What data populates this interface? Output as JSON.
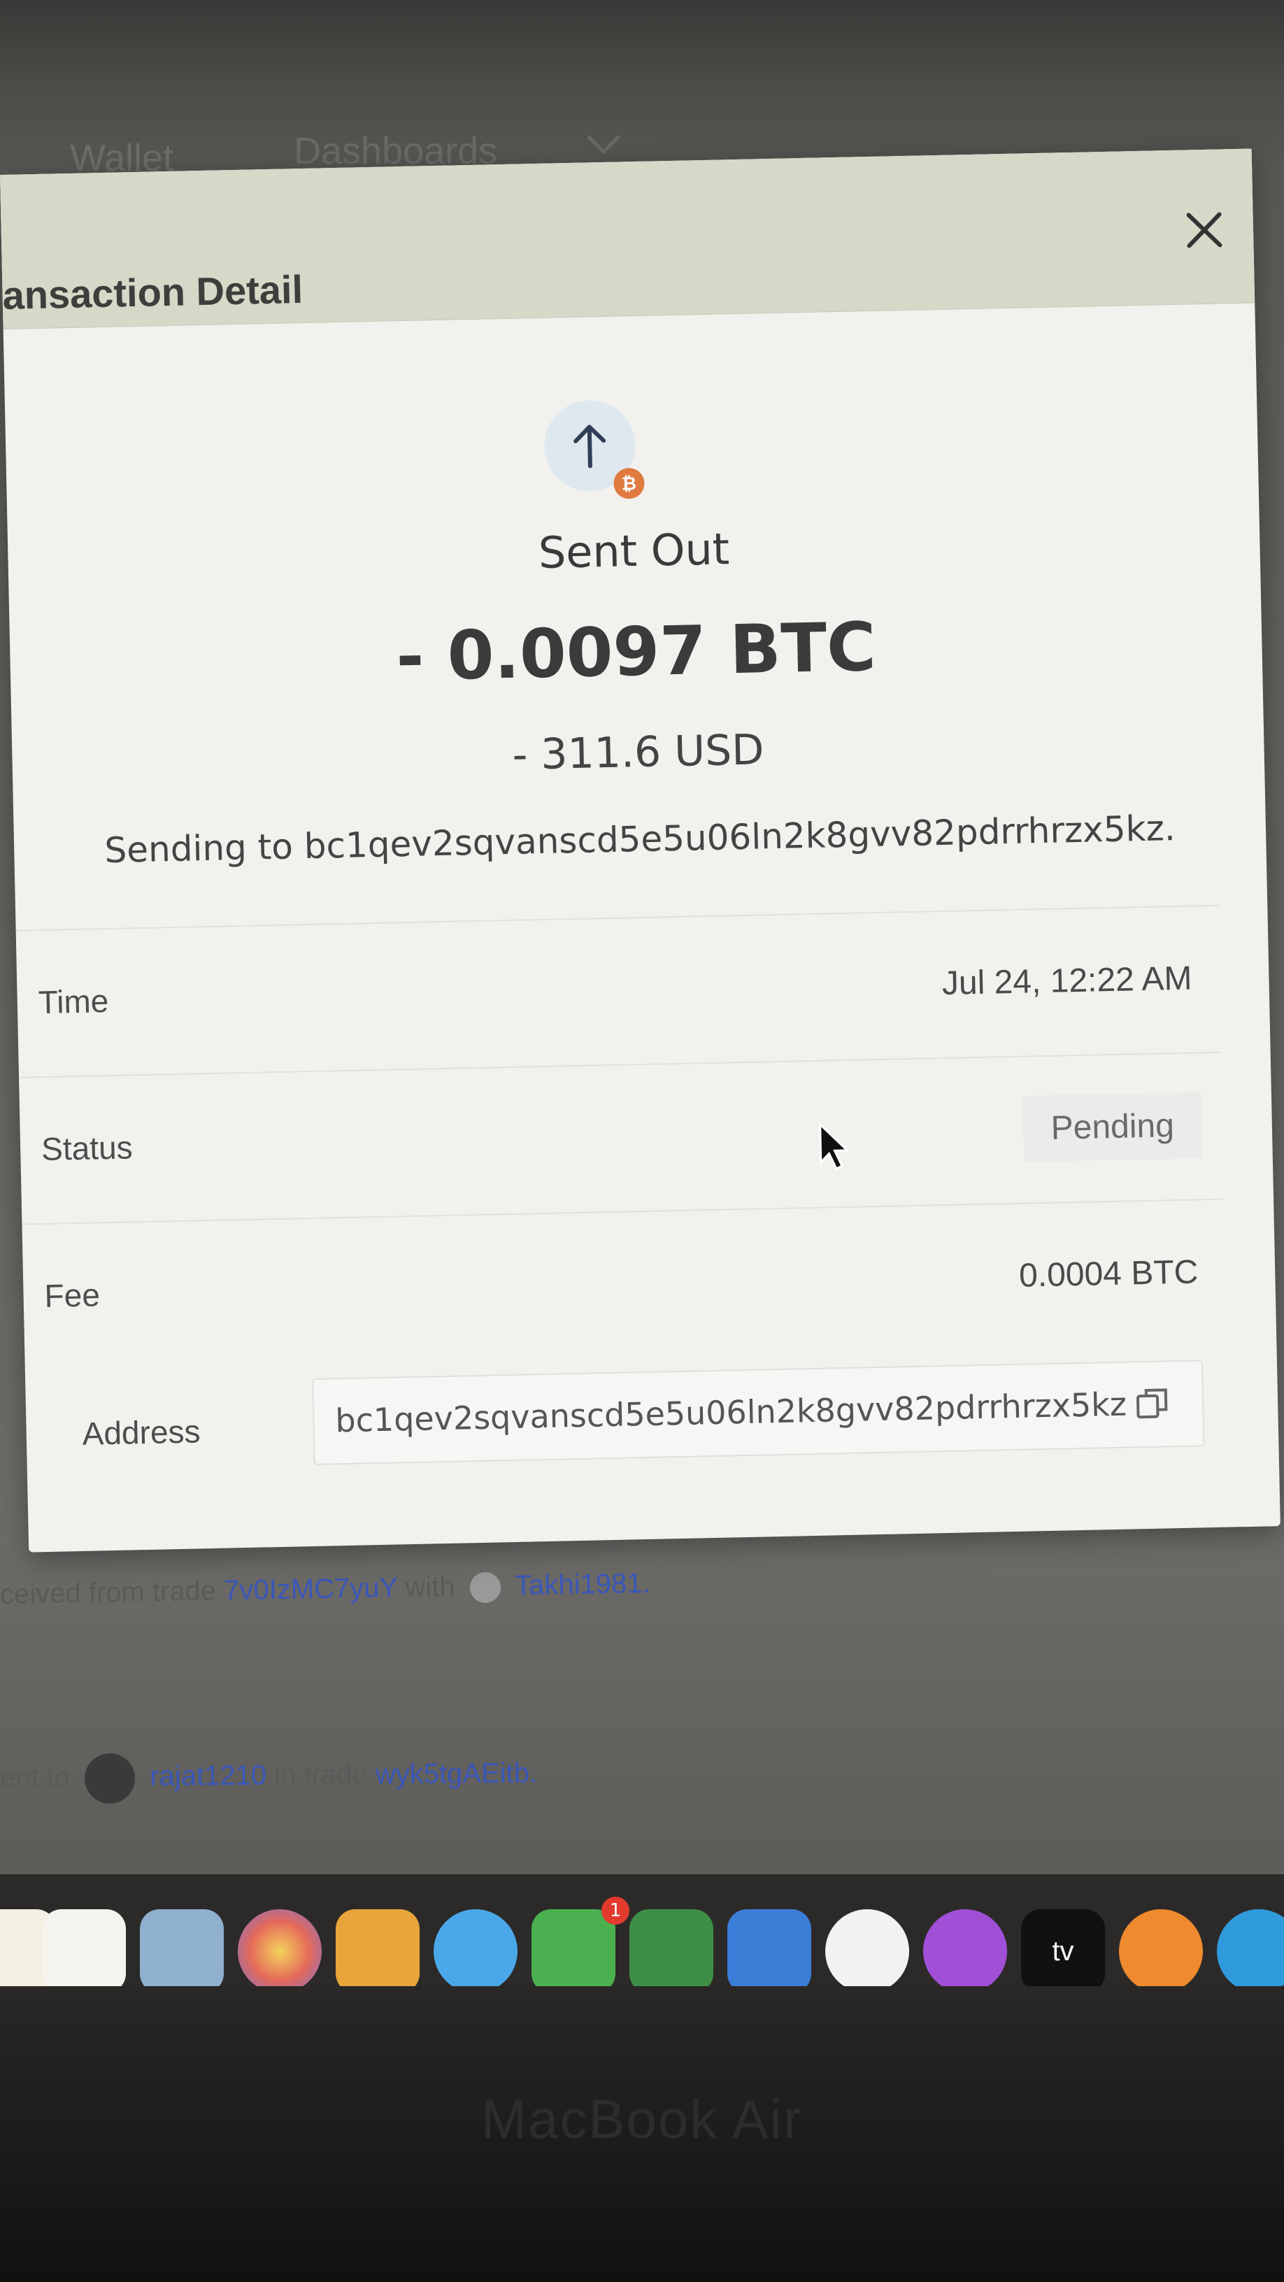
{
  "nav": {
    "wallet": "Wallet",
    "dashboards": "Dashboards"
  },
  "modal": {
    "title": "ansaction Detail",
    "type_label": "Sent Out",
    "amount": "- 0.0097 BTC",
    "fiat": "- 311.6 USD",
    "sending_to": "Sending to bc1qev2sqvanscd5e5u06ln2k8gvv82pdrrhrzx5kz.",
    "rows": {
      "time": {
        "label": "Time",
        "value": "Jul 24, 12:22 AM"
      },
      "status": {
        "label": "Status",
        "value": "Pending"
      },
      "fee": {
        "label": "Fee",
        "value": "0.0004 BTC"
      },
      "address": {
        "label": "Address",
        "value": "bc1qev2sqvanscd5e5u06ln2k8gvv82pdrrhrzx5kz"
      }
    }
  },
  "background": {
    "line1_prefix": "ceived from trade",
    "line1_trade": "7v0IzMC7yuY",
    "line1_with": "with",
    "line1_user": "Takhi1981.",
    "line2_prefix": "ent to",
    "line2_user": "rajat1210",
    "line2_mid": "in trade",
    "line2_trade": "wyk5tgAEitb."
  },
  "dock": {
    "tv_label": "tv",
    "messages_badge": "1"
  },
  "device": {
    "brand": "MacBook Air"
  },
  "colors": {
    "accent_btc": "#e07a3f",
    "link": "#3a57b8",
    "header_bg": "#d6d8c8"
  }
}
